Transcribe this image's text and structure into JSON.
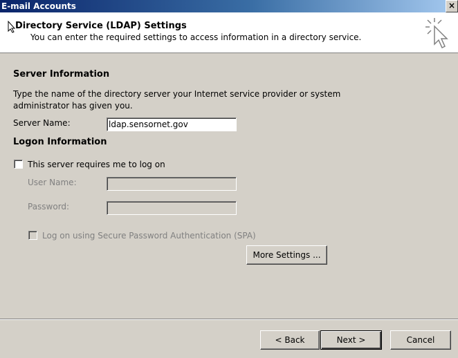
{
  "window": {
    "title": "E-mail Accounts",
    "close_glyph": "×"
  },
  "header": {
    "title": "Directory Service (LDAP) Settings",
    "subtitle": "You can enter the required settings to access information in a directory service.",
    "icon": "wizard-cursor-icon"
  },
  "server_info": {
    "heading": "Server Information",
    "description_line1": "Type the name of the directory server your Internet service provider or system",
    "description_line2": "administrator has given you.",
    "server_name_label": "Server Name:",
    "server_name_value": "ldap.sensornet.gov"
  },
  "logon_info": {
    "heading": "Logon Information",
    "requires_logon_label": "This server requires me to log on",
    "requires_logon_checked": false,
    "user_name_label": "User Name:",
    "user_name_value": "",
    "password_label": "Password:",
    "password_value": "",
    "spa_label": "Log on using Secure Password Authentication (SPA)"
  },
  "buttons": {
    "more_settings": "More Settings ...",
    "back": "< Back",
    "next": "Next >",
    "cancel": "Cancel"
  }
}
